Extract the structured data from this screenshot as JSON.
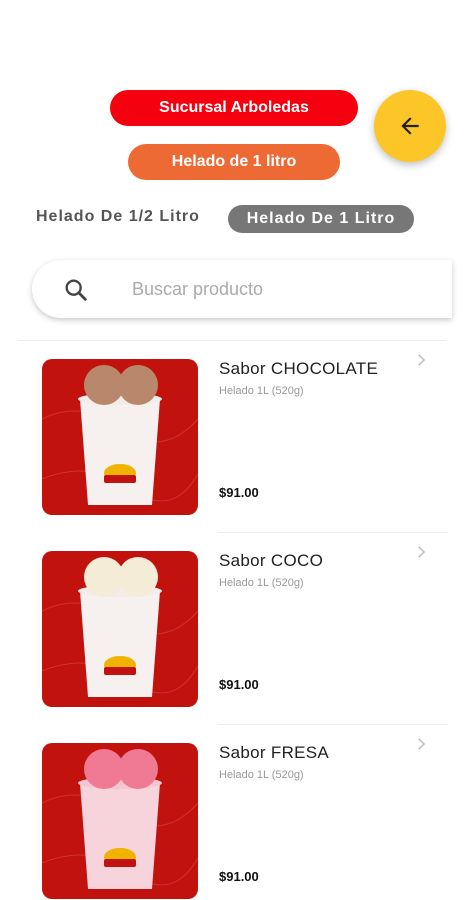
{
  "header": {
    "branch_label": "Sucursal Arboledas",
    "category_label": "Helado de 1 litro",
    "back_icon": "arrow-left-icon",
    "colors": {
      "branch": "#f5000e",
      "category": "#ee6a35",
      "fab": "#fdc628"
    }
  },
  "tabs": [
    {
      "label": "Helado De 1/2 Litro",
      "active": false
    },
    {
      "label": "Helado De 1 Litro",
      "active": true
    }
  ],
  "search": {
    "placeholder": "Buscar producto",
    "value": ""
  },
  "products": [
    {
      "name": "Sabor CHOCOLATE",
      "description": "Helado 1L (520g)",
      "price": "$91.00",
      "scoop_color": "#b8876c"
    },
    {
      "name": "Sabor COCO",
      "description": "Helado 1L (520g)",
      "price": "$91.00",
      "scoop_color": "#f4ecd6"
    },
    {
      "name": "Sabor FRESA",
      "description": "Helado 1L (520g)",
      "price": "$91.00",
      "scoop_color": "#f07a93"
    }
  ]
}
